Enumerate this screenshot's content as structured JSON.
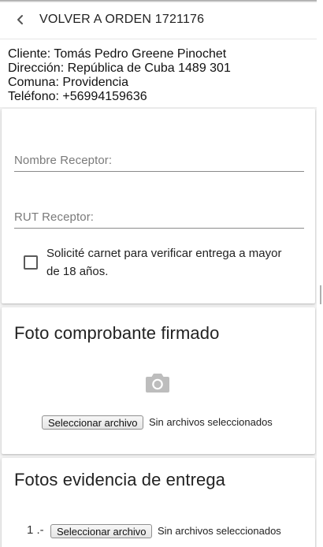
{
  "header": {
    "back_label": "VOLVER A ORDEN 1721176",
    "back_icon": "chevron-left-icon"
  },
  "client": {
    "lines": [
      "Cliente: Tomás Pedro Greene Pinochet",
      "Dirección: República de Cuba 1489 301",
      "Comuna: Providencia",
      "Teléfono: +56994159636"
    ]
  },
  "form": {
    "receiver_name_label": "Nombre Receptor:",
    "receiver_name_value": "",
    "receiver_rut_label": "RUT Receptor:",
    "receiver_rut_value": "",
    "id_check_label": "Solicité carnet para verificar entrega a mayor de 18 años.",
    "id_check_checked": false
  },
  "signed_receipt": {
    "title": "Foto comprobante firmado",
    "icon": "camera-icon",
    "file_button": "Seleccionar archivo",
    "file_status": "Sin archivos seleccionados"
  },
  "delivery_evidence": {
    "title": "Fotos evidencia de entrega",
    "items": [
      {
        "index": "1 .-",
        "file_button": "Seleccionar archivo",
        "file_status": "Sin archivos seleccionados"
      }
    ]
  },
  "colors": {
    "page_background": "#f2f2f2",
    "card_background": "#ffffff",
    "icon_gray": "#bdbdbd"
  }
}
